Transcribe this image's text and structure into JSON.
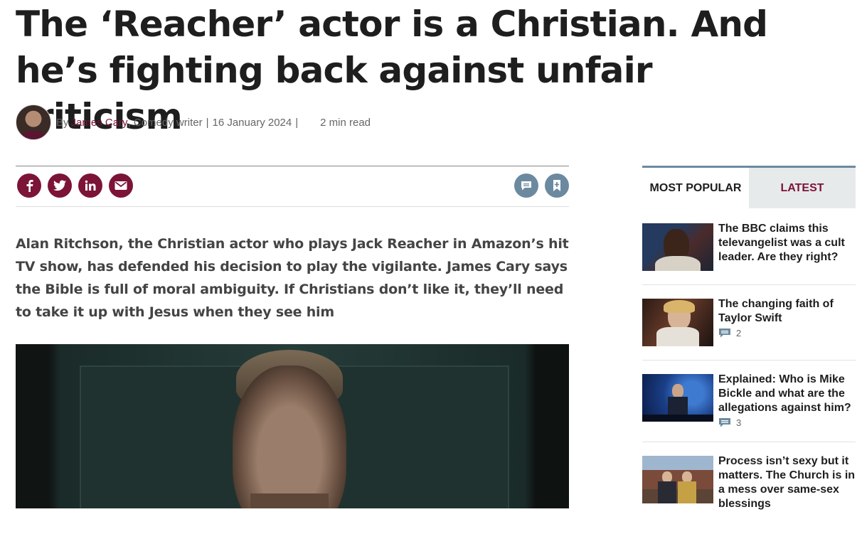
{
  "article": {
    "headline": "The ‘Reacher’ actor is a Christian. And he’s fighting back against unfair criticism",
    "byline": {
      "by": "By",
      "author": "James Cary",
      "role": ", Comedy writer",
      "sep1": "|",
      "date": "16 January 2024",
      "sep2": "|",
      "read_time": "2 min read"
    },
    "standfirst": "Alan Ritchson, the Christian actor who plays Jack Reacher in Amazon’s hit TV show, has defended his decision to play the vigilante. James Cary says the Bible is full of moral ambiguity. If Christians don’t like it, they’ll need to take it up with Jesus when they see him",
    "share_icons": [
      "facebook-icon",
      "twitter-icon",
      "linkedin-icon",
      "email-icon"
    ],
    "tool_icons": [
      "comment-icon",
      "bookmark-icon"
    ]
  },
  "sidebar": {
    "tabs": [
      {
        "label": "MOST POPULAR"
      },
      {
        "label": "LATEST"
      }
    ],
    "items": [
      {
        "title": "The BBC claims this televangelist was a cult leader. Are they right?",
        "comments": ""
      },
      {
        "title": "The changing faith of Taylor Swift",
        "comments": "2"
      },
      {
        "title": "Explained: Who is Mike Bickle and what are the allegations against him?",
        "comments": "3"
      },
      {
        "title": "Process isn’t sexy but it matters. The Church is in a mess over same-sex blessings",
        "comments": ""
      }
    ]
  },
  "colors": {
    "brand": "#7b1437",
    "accent": "#6b8aa0",
    "tab_bg": "#e7eaea"
  }
}
